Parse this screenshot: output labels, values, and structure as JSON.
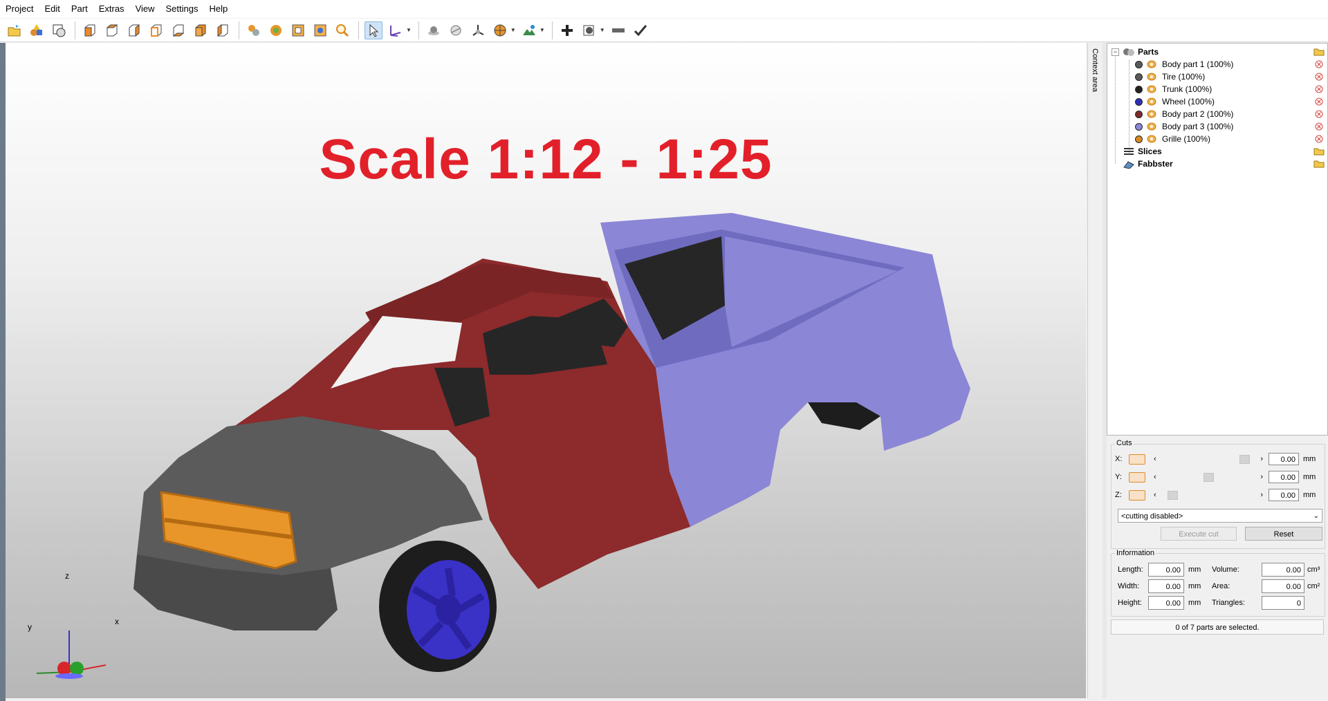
{
  "menu": [
    "Project",
    "Edit",
    "Part",
    "Extras",
    "View",
    "Settings",
    "Help"
  ],
  "toolbar": {
    "icons": [
      "open-icon",
      "add-shapes-icon",
      "copy-view-icon",
      "view-front-icon",
      "view-back-icon",
      "view-left-icon",
      "view-right-icon",
      "view-top-icon",
      "view-bottom-icon",
      "view-iso-icon",
      "material-icon",
      "color-icon",
      "fit-icon",
      "transform-icon",
      "zoom-icon",
      "select-icon",
      "measure-icon",
      "sphere-icon",
      "shading-icon",
      "axes-icon",
      "section-icon",
      "terrain-icon",
      "add-icon",
      "options-icon",
      "ruler-icon",
      "check-icon"
    ]
  },
  "viewport": {
    "title": "Scale 1:12 - 1:25",
    "axes": {
      "x": "x",
      "y": "y",
      "z": "z"
    },
    "colors": {
      "body1": "#8c2a2c",
      "body2": "#5b5b5b",
      "body3": "#8f8bd6",
      "wheel": "#3a31c7",
      "tire": "#1d1d1d",
      "grille": "#e8962a",
      "trunk": "#2b2b2b"
    }
  },
  "context_tab": "Context area",
  "tree": {
    "parts_label": "Parts",
    "parts": [
      {
        "label": "Body part 1 (100%)",
        "color": "#5a5a5a"
      },
      {
        "label": "Tire (100%)",
        "color": "#5a5a5a"
      },
      {
        "label": "Trunk (100%)",
        "color": "#222222"
      },
      {
        "label": "Wheel (100%)",
        "color": "#2d2fb8"
      },
      {
        "label": "Body part 2 (100%)",
        "color": "#7e2a2c"
      },
      {
        "label": "Body part 3 (100%)",
        "color": "#8b86d6"
      },
      {
        "label": "Grille (100%)",
        "color": "#d98a1f"
      }
    ],
    "slices_label": "Slices",
    "fabbster_label": "Fabbster"
  },
  "cuts": {
    "title": "Cuts",
    "rows": [
      {
        "axis": "X:",
        "value": "0.00",
        "unit": "mm",
        "thumb": 0.93
      },
      {
        "axis": "Y:",
        "value": "0.00",
        "unit": "mm",
        "thumb": 0.5
      },
      {
        "axis": "Z:",
        "value": "0.00",
        "unit": "mm",
        "thumb": 0.07
      }
    ],
    "mode": "<cutting disabled>",
    "execute_label": "Execute cut",
    "reset_label": "Reset"
  },
  "information": {
    "title": "Information",
    "length_label": "Length:",
    "length": "0.00",
    "length_unit": "mm",
    "width_label": "Width:",
    "width": "0.00",
    "width_unit": "mm",
    "height_label": "Height:",
    "height": "0.00",
    "height_unit": "mm",
    "volume_label": "Volume:",
    "volume": "0.00",
    "volume_unit": "cm³",
    "area_label": "Area:",
    "area": "0.00",
    "area_unit": "cm²",
    "triangles_label": "Triangles:",
    "triangles": "0"
  },
  "status": "0 of 7 parts are selected."
}
